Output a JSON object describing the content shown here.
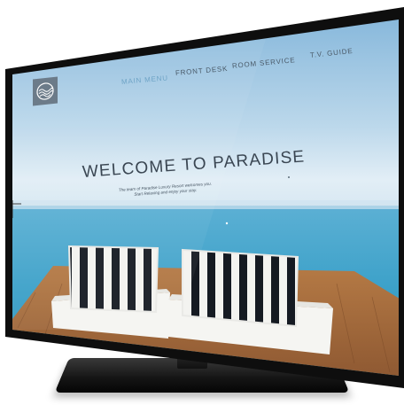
{
  "menu": {
    "items": [
      {
        "label": "MAIN MENU",
        "active": true
      },
      {
        "label": "FRONT DESK",
        "active": false
      },
      {
        "label": "ROOM SERVICE",
        "active": false
      },
      {
        "label": "T.V. GUIDE",
        "active": false
      }
    ]
  },
  "welcome": {
    "title": "WELCOME TO PARADISE",
    "subtitle_line1": "The team of Paradise Luxury Resort welcomes you.",
    "subtitle_line2": "Start Relaxing and enjoy your stay."
  },
  "logo": {
    "icon": "wave-circle-logo-icon"
  },
  "colors": {
    "sky_top": "#7fb3d9",
    "sky_bottom": "#d7e8f3",
    "sea": "#3fa3c9",
    "deck": "#a0673a",
    "bezel": "#111111",
    "nav_active": "#6fa4c6"
  }
}
